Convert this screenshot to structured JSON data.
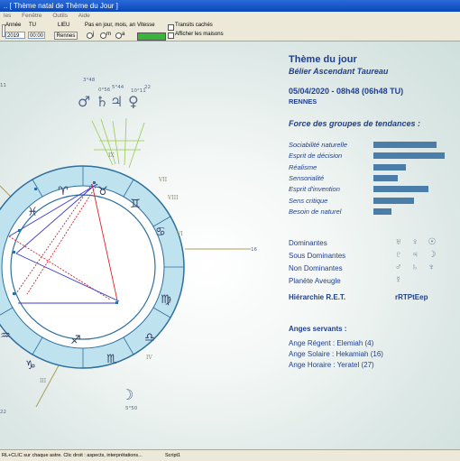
{
  "window": {
    "title": "[ Thème natal de Thème du Jour ]",
    "title_prefix": ".."
  },
  "menu": [
    "les",
    "Fenêtre",
    "Outils",
    "Aide"
  ],
  "toolbar": {
    "year_label": "Année",
    "year_value": "2019",
    "tu_label": "TU",
    "tu_value": "00:00",
    "lieu_label": "LIEU",
    "lieu_value": "Rennes",
    "step_label": "Pas en jour, mois, an",
    "step_options": [
      "j",
      "m",
      "a"
    ],
    "speed_label": "Vitesse",
    "transits_label": "Transits cachés",
    "houses_label": "Afficher les maisons"
  },
  "chart": {
    "outer_labels": [
      "3°48",
      "0°56",
      "5°44",
      "10°11",
      "22",
      "11",
      "16",
      "5°50",
      "22"
    ],
    "house_numbers": [
      "IX",
      "VII",
      "VIII",
      "VI",
      "V",
      "IV",
      "III"
    ],
    "zodiac_glyphs": [
      "♓",
      "♈",
      "♉",
      "♊",
      "♋",
      "♌",
      "♍",
      "♎",
      "♏",
      "♐",
      "♑",
      "♒"
    ],
    "planet_glyphs": [
      "♂",
      "♄",
      "♃",
      "♀",
      "☽"
    ],
    "aspect_colors": {
      "red": "#e0202a",
      "blue": "#3a3ad0",
      "ring": "#bfe2ef",
      "ring_border": "#2d6f9e"
    }
  },
  "panel": {
    "theme_title": "Thème du jour",
    "subtitle": "Bélier Ascendant Taureau",
    "datetime": "05/04/2020 - 08h48 (06h48 TU)",
    "city": "RENNES",
    "force_title": "Force des groupes de tendances :",
    "tendencies": [
      {
        "label": "Sociabilité naturelle",
        "value": 0.78
      },
      {
        "label": "Esprit de décision",
        "value": 0.88
      },
      {
        "label": "Réalisme",
        "value": 0.4
      },
      {
        "label": "Sensorialité",
        "value": 0.3
      },
      {
        "label": "Esprit d'invention",
        "value": 0.68
      },
      {
        "label": "Sens critique",
        "value": 0.5
      },
      {
        "label": "Besoin de naturel",
        "value": 0.22
      }
    ],
    "dominants": [
      {
        "label": "Dominantes",
        "symbols": "♅ ♀ ☉"
      },
      {
        "label": "Sous Dominantes",
        "symbols": "♇ ♃ ☽"
      },
      {
        "label": "Non Dominantes",
        "symbols": "♂ ♄ ♆"
      },
      {
        "label": "Planète Aveugle",
        "symbols": "☿"
      }
    ],
    "hierarchy_label": "Hiérarchie R.E.T.",
    "hierarchy_value": "rRTPtEep",
    "anges_title": "Anges servants :",
    "anges": [
      "Ange Régent : Elemiah (4)",
      "Ange Solaire : Hekamiah (16)",
      "Ange Horaire : Yeratel (27)"
    ]
  },
  "status": {
    "left": "RL+CLIC sur chaque astre. Clic droit : aspects, interprétations...",
    "middle": "Script1"
  }
}
